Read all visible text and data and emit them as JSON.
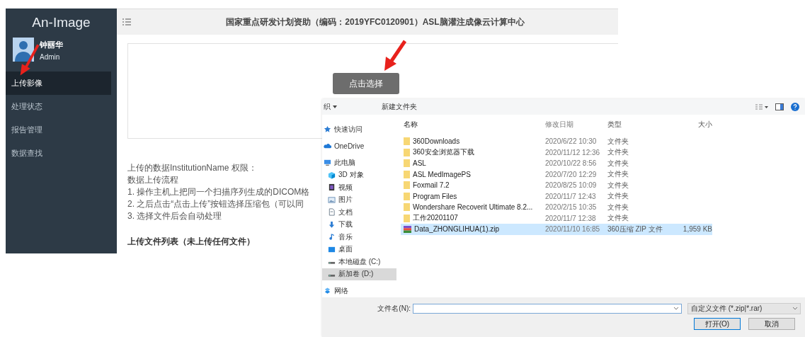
{
  "sidebar": {
    "title": "An-Image",
    "user": {
      "name": "钟丽华",
      "role": "Admin"
    },
    "items": [
      {
        "label": "上传影像",
        "selected": true
      },
      {
        "label": "处理状态",
        "selected": false
      },
      {
        "label": "报告管理",
        "selected": false
      },
      {
        "label": "数据查找",
        "selected": false
      }
    ]
  },
  "header": {
    "title": "国家重点研发计划资助（编码：2019YFC0120901）ASL脑灌注成像云计算中心"
  },
  "upload": {
    "button": "点击选择"
  },
  "info": {
    "lines": [
      "上传的数据InstitutionName 权限：",
      "数据上传流程",
      "1. 操作主机上把同一个扫描序列生成的DICOM格",
      "2. 之后点击“点击上传”按钮选择压缩包（可以同",
      "3. 选择文件后会自动处理"
    ],
    "list_title": "上传文件列表（未上传任何文件）"
  },
  "dialog": {
    "toolbar": {
      "organize": "织",
      "new_folder": "新建文件夹"
    },
    "nav": [
      {
        "label": "快速访问",
        "kind": "star",
        "selected": false
      },
      {
        "label": "OneDrive",
        "kind": "cloud",
        "selected": false
      },
      {
        "label": "此电脑",
        "kind": "pc",
        "selected": false,
        "children": [
          {
            "label": "3D 对象",
            "kind": "cube",
            "selected": false
          },
          {
            "label": "视频",
            "kind": "video",
            "selected": false
          },
          {
            "label": "图片",
            "kind": "image",
            "selected": false
          },
          {
            "label": "文档",
            "kind": "doc",
            "selected": false
          },
          {
            "label": "下载",
            "kind": "download",
            "selected": false
          },
          {
            "label": "音乐",
            "kind": "music",
            "selected": false
          },
          {
            "label": "桌面",
            "kind": "desktop",
            "selected": false
          },
          {
            "label": "本地磁盘 (C:)",
            "kind": "drive",
            "selected": false
          },
          {
            "label": "新加卷 (D:)",
            "kind": "drive",
            "selected": true
          }
        ]
      },
      {
        "label": "网络",
        "kind": "network",
        "selected": false
      }
    ],
    "columns": [
      "名称",
      "修改日期",
      "类型",
      "大小"
    ],
    "files": [
      {
        "name": "360Downloads",
        "date": "2020/6/22 10:30",
        "type": "文件夹",
        "kind": "folder",
        "selected": false
      },
      {
        "name": "360安全浏览器下载",
        "date": "2020/11/12 12:36",
        "type": "文件夹",
        "kind": "folder",
        "selected": false
      },
      {
        "name": "ASL",
        "date": "2020/10/22 8:56",
        "type": "文件夹",
        "kind": "folder",
        "selected": false
      },
      {
        "name": "ASL MedImagePS",
        "date": "2020/7/20 12:29",
        "type": "文件夹",
        "kind": "folder",
        "selected": false
      },
      {
        "name": "Foxmail 7.2",
        "date": "2020/8/25 10:09",
        "type": "文件夹",
        "kind": "folder",
        "selected": false
      },
      {
        "name": "Program Files",
        "date": "2020/11/7 12:43",
        "type": "文件夹",
        "kind": "folder",
        "selected": false
      },
      {
        "name": "Wondershare Recoverit Ultimate 8.2...",
        "date": "2020/2/15 10:35",
        "type": "文件夹",
        "kind": "folder",
        "selected": false
      },
      {
        "name": "工作20201107",
        "date": "2020/11/7 12:38",
        "type": "文件夹",
        "kind": "folder",
        "selected": false
      },
      {
        "name": "Data_ZHONGLIHUA(1).zip",
        "date": "2020/11/10 16:85",
        "type": "360压缩 ZIP 文件",
        "size": "1,959 KB",
        "kind": "zip",
        "selected": true
      }
    ],
    "filename_label": "文件名(N):",
    "filter": "自定义文件 (*.zip|*.rar)",
    "buttons": [
      {
        "label": "打开(O)",
        "kind": "default"
      },
      {
        "label": "取消",
        "kind": "normal"
      }
    ]
  }
}
